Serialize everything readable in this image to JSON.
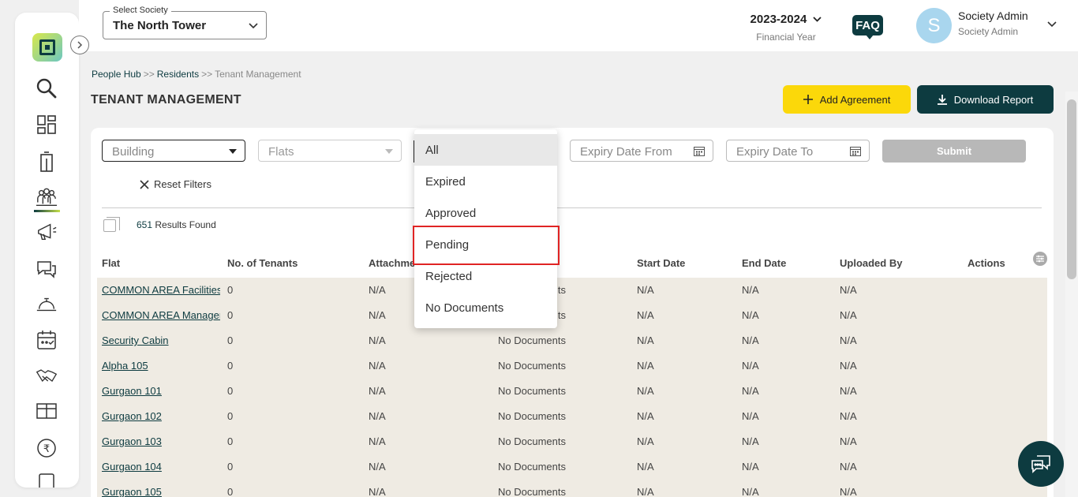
{
  "header": {
    "society_label": "Select Society",
    "society_value": "The North Tower",
    "financial_year": "2023-2024",
    "financial_year_label": "Financial Year",
    "faq": "FAQ",
    "avatar_initial": "S",
    "user_name": "Society Admin",
    "user_role": "Society Admin"
  },
  "breadcrumb": {
    "items": [
      "People Hub",
      "Residents",
      "Tenant Management"
    ],
    "separator": ">>"
  },
  "page": {
    "title": "TENANT MANAGEMENT",
    "add_button": "Add Agreement",
    "download_button": "Download Report"
  },
  "filters": {
    "building_placeholder": "Building",
    "flats_placeholder": "Flats",
    "expiry_from_placeholder": "Expiry Date From",
    "expiry_to_placeholder": "Expiry Date To",
    "submit": "Submit",
    "reset": "Reset Filters",
    "results_count": "651",
    "results_label": "Results Found"
  },
  "status_dropdown": {
    "options": [
      "All",
      "Expired",
      "Approved",
      "Pending",
      "Rejected",
      "No Documents"
    ],
    "selected": "All",
    "highlighted": "Pending"
  },
  "table": {
    "headers": [
      "Flat",
      "No. of Tenants",
      "Attachme",
      "Start Date",
      "End Date",
      "Uploaded By",
      "Actions"
    ],
    "rows": [
      {
        "flat": "COMMON AREA Facilities",
        "tenants": "0",
        "attachment": "N/A",
        "status": "No Documents",
        "start": "N/A",
        "end": "N/A",
        "uploaded": "N/A"
      },
      {
        "flat": "COMMON AREA Manager",
        "tenants": "0",
        "attachment": "N/A",
        "status": "No Documents",
        "start": "N/A",
        "end": "N/A",
        "uploaded": "N/A"
      },
      {
        "flat": "Security Cabin",
        "tenants": "0",
        "attachment": "N/A",
        "status": "No Documents",
        "start": "N/A",
        "end": "N/A",
        "uploaded": "N/A"
      },
      {
        "flat": "Alpha 105",
        "tenants": "0",
        "attachment": "N/A",
        "status": "No Documents",
        "start": "N/A",
        "end": "N/A",
        "uploaded": "N/A"
      },
      {
        "flat": "Gurgaon 101",
        "tenants": "0",
        "attachment": "N/A",
        "status": "No Documents",
        "start": "N/A",
        "end": "N/A",
        "uploaded": "N/A"
      },
      {
        "flat": "Gurgaon 102",
        "tenants": "0",
        "attachment": "N/A",
        "status": "No Documents",
        "start": "N/A",
        "end": "N/A",
        "uploaded": "N/A"
      },
      {
        "flat": "Gurgaon 103",
        "tenants": "0",
        "attachment": "N/A",
        "status": "No Documents",
        "start": "N/A",
        "end": "N/A",
        "uploaded": "N/A"
      },
      {
        "flat": "Gurgaon 104",
        "tenants": "0",
        "attachment": "N/A",
        "status": "No Documents",
        "start": "N/A",
        "end": "N/A",
        "uploaded": "N/A"
      },
      {
        "flat": "Gurgaon 105",
        "tenants": "0",
        "attachment": "N/A",
        "status": "No Documents",
        "start": "N/A",
        "end": "N/A",
        "uploaded": "N/A"
      }
    ]
  },
  "sidebar": {
    "icons": [
      "search-icon",
      "dashboard-grid-icon",
      "building-icon",
      "people-icon",
      "megaphone-icon",
      "chat-icon",
      "service-bell-icon",
      "calendar-icon",
      "handshake-icon",
      "parcel-box-icon",
      "rupee-icon",
      "document-icon"
    ]
  },
  "colors": {
    "primary": "#0d3b40",
    "accent": "#fbd80a",
    "highlight_border": "#e02424"
  }
}
